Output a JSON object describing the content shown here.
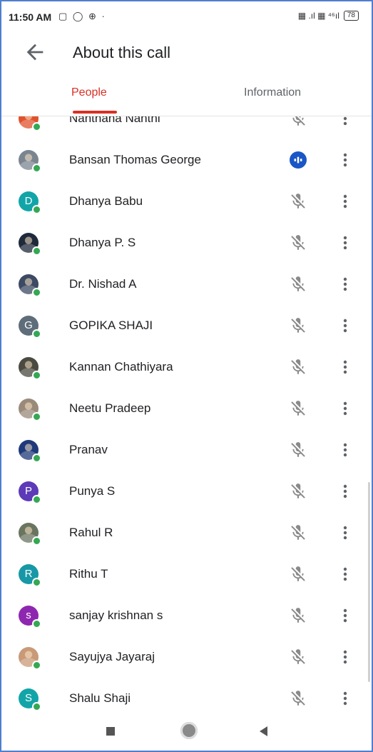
{
  "status_bar": {
    "time": "11:50 AM",
    "left_icons": "▢ ◯ ⊕ ·",
    "right_icons": "▦ .ıl ▦ ⁴⁶ıl",
    "battery": "78"
  },
  "header": {
    "title": "About this call"
  },
  "tabs": [
    {
      "label": "People",
      "active": true
    },
    {
      "label": "Information",
      "active": false
    }
  ],
  "participants": [
    {
      "name": "Nanthana Nanthi",
      "avatar_type": "photo",
      "avatar_color": "#e0522c",
      "mic": "muted"
    },
    {
      "name": "Bansan Thomas George",
      "avatar_type": "photo",
      "avatar_color": "#7a8590",
      "mic": "speaking"
    },
    {
      "name": "Dhanya Babu",
      "avatar_type": "letter",
      "letter": "D",
      "avatar_color": "#12a5a8",
      "mic": "muted"
    },
    {
      "name": "Dhanya P. S",
      "avatar_type": "photo",
      "avatar_color": "#1e2a3a",
      "mic": "muted"
    },
    {
      "name": "Dr. Nishad A",
      "avatar_type": "photo",
      "avatar_color": "#3c4a63",
      "mic": "muted"
    },
    {
      "name": "GOPIKA SHAJI",
      "avatar_type": "letter",
      "letter": "G",
      "avatar_color": "#5f6d7a",
      "mic": "muted"
    },
    {
      "name": "Kannan Chathiyara",
      "avatar_type": "photo",
      "avatar_color": "#4a4a40",
      "mic": "muted"
    },
    {
      "name": "Neetu Pradeep",
      "avatar_type": "photo",
      "avatar_color": "#9a8a7a",
      "mic": "muted"
    },
    {
      "name": "Pranav",
      "avatar_type": "photo",
      "avatar_color": "#1f3a7a",
      "mic": "muted"
    },
    {
      "name": "Punya S",
      "avatar_type": "letter",
      "letter": "P",
      "avatar_color": "#5c3ab8",
      "mic": "muted"
    },
    {
      "name": "Rahul R",
      "avatar_type": "photo",
      "avatar_color": "#6a7560",
      "mic": "muted"
    },
    {
      "name": "Rithu T",
      "avatar_type": "letter",
      "letter": "R",
      "avatar_color": "#1898a6",
      "mic": "muted"
    },
    {
      "name": "sanjay krishnan s",
      "avatar_type": "letter",
      "letter": "s",
      "avatar_color": "#8e27b0",
      "mic": "muted"
    },
    {
      "name": "Sayujya Jayaraj",
      "avatar_type": "photo",
      "avatar_color": "#c99a78",
      "mic": "muted"
    },
    {
      "name": "Shalu Shaji",
      "avatar_type": "letter",
      "letter": "S",
      "avatar_color": "#12a5a8",
      "mic": "muted"
    }
  ],
  "colors": {
    "accent": "#d93025",
    "speaking": "#1a56c6",
    "online_dot": "#34a853"
  }
}
